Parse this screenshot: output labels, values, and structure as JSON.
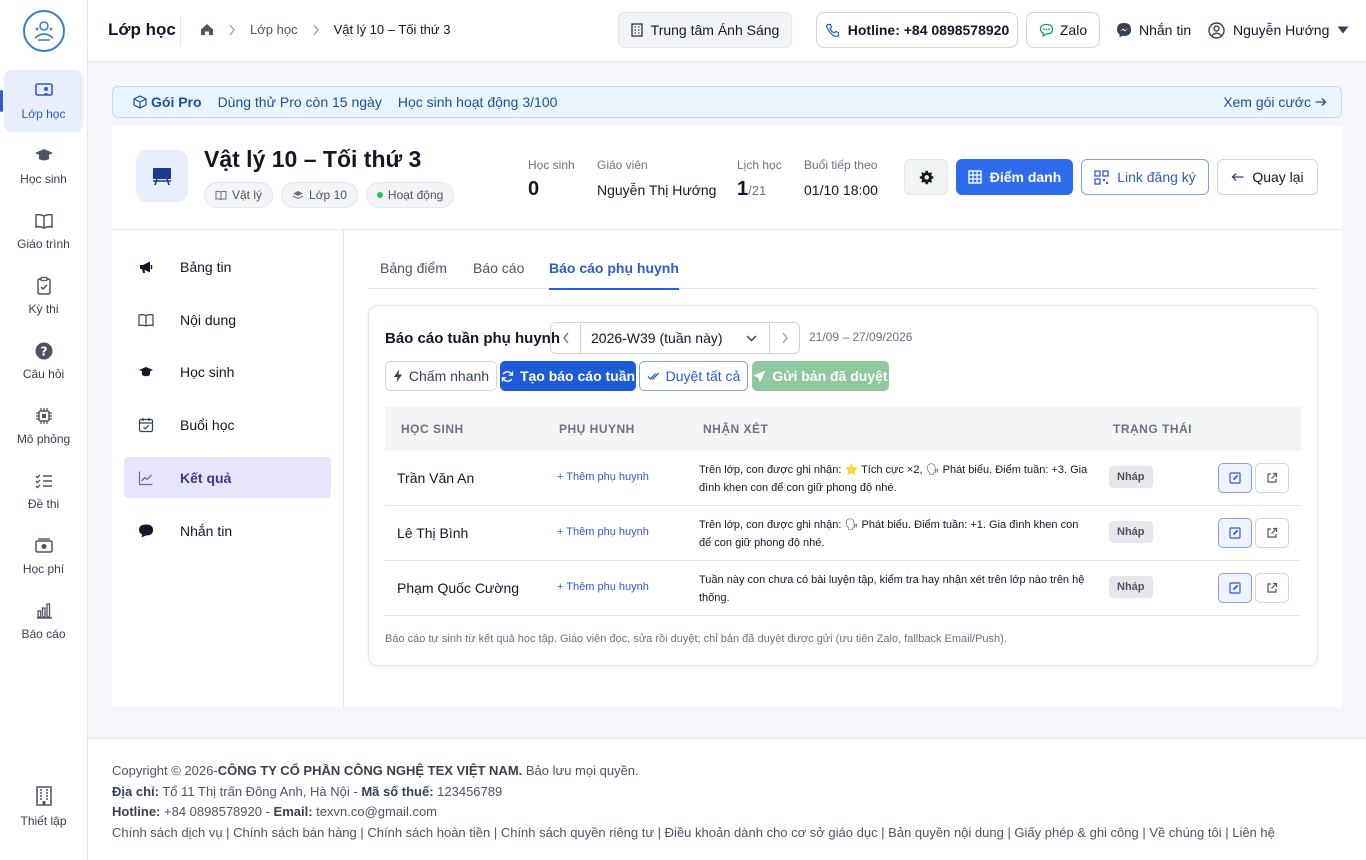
{
  "rail": {
    "items": [
      {
        "label": "Lớp học"
      },
      {
        "label": "Học sinh"
      },
      {
        "label": "Giáo trình"
      },
      {
        "label": "Kỳ thi"
      },
      {
        "label": "Câu hỏi"
      },
      {
        "label": "Mô phỏng"
      },
      {
        "label": "Đề thi"
      },
      {
        "label": "Học phí"
      },
      {
        "label": "Báo cáo"
      }
    ],
    "settings": "Thiết lập"
  },
  "header": {
    "title": "Lớp học",
    "breadcrumb": [
      "Lớp học",
      "Vật lý 10 – Tối thứ 3"
    ],
    "center": "Trung tâm Ánh Sáng",
    "hotline": "Hotline: +84 0898578920",
    "zalo": "Zalo",
    "message": "Nhắn tin",
    "user": "Nguyễn Hướng"
  },
  "pro": {
    "label": "Gói Pro",
    "trial": "Dùng thử Pro còn 15 ngày",
    "active": "Học sinh hoạt động 3/100",
    "link": "Xem gói cước"
  },
  "class": {
    "name": "Vật lý 10 – Tối thứ 3",
    "tags": [
      "Vật lý",
      "Lớp 10",
      "Hoạt động"
    ],
    "stats": {
      "students_label": "Học sinh",
      "students": "0",
      "teacher_label": "Giáo viên",
      "teacher": "Nguyễn Thị Hướng",
      "schedule_label": "Lịch học",
      "schedule_done": "1",
      "schedule_total": "/21",
      "next_label": "Buổi tiếp theo",
      "next": "01/10 18:00"
    },
    "buttons": {
      "attendance": "Điểm danh",
      "reglink": "Link đăng ký",
      "back": "Quay lại"
    }
  },
  "subnav": [
    "Bảng tin",
    "Nội dung",
    "Học sinh",
    "Buổi học",
    "Kết quả",
    "Nhắn tin"
  ],
  "tabs": [
    "Bảng điểm",
    "Báo cáo",
    "Báo cáo phụ huynh"
  ],
  "report": {
    "title": "Báo cáo tuần phụ huynh",
    "week": "2026-W39 (tuần này)",
    "range": "21/09 – 27/09/2026",
    "actions": {
      "quick": "Chấm nhanh",
      "create": "Tạo báo cáo tuần",
      "approve": "Duyệt tất cả",
      "send": "Gửi bản đã duyệt"
    },
    "columns": [
      "HỌC SINH",
      "PHỤ HUYNH",
      "NHẬN XÉT",
      "TRẠNG THÁI"
    ],
    "rows": [
      {
        "student": "Trần Văn An",
        "parent": "+ Thêm phụ huynh",
        "note": "Trên lớp, con được ghi nhận: ⭐ Tích cực ×2, 🗣 Phát biểu. Điểm tuần: +3. Gia đình khen con để con giữ phong độ nhé.",
        "status": "Nháp"
      },
      {
        "student": "Lê Thị Bình",
        "parent": "+ Thêm phụ huynh",
        "note": "Trên lớp, con được ghi nhận: 🗣 Phát biểu. Điểm tuần: +1. Gia đình khen con để con giữ phong độ nhé.",
        "status": "Nháp"
      },
      {
        "student": "Phạm Quốc Cường",
        "parent": "+ Thêm phụ huynh",
        "note": "Tuần này con chưa có bài luyện tập, kiểm tra hay nhận xét trên lớp nào trên hệ thống.",
        "status": "Nháp"
      }
    ],
    "footnote": "Báo cáo tự sinh từ kết quả học tập. Giáo viên đọc, sửa rồi duyệt; chỉ bản đã duyệt được gửi (ưu tiên Zalo, fallback Email/Push)."
  },
  "footer": {
    "copyright_prefix": "Copyright © 2026-",
    "company": "CÔNG TY CỔ PHẦN CÔNG NGHỆ TEX VIỆT NAM.",
    "rights": " Bảo lưu mọi quyền.",
    "address_label": "Địa chỉ:",
    "address": " Tổ 11 Thị trấn Đông Anh, Hà Nội - ",
    "tax_label": "Mã số thuế:",
    "tax": " 123456789",
    "hotline_label": "Hotline:",
    "hotline": " +84 0898578920 - ",
    "email_label": "Email:",
    "email": " texvn.co@gmail.com",
    "links": "Chính sách dịch vụ | Chính sách bán hàng | Chính sách hoàn tiền | Chính sách quyền riêng tư | Điều khoản dành cho cơ sở giáo dục | Bản quyền nội dung | Giấy phép & ghi công | Về chúng tôi | Liên hệ"
  }
}
